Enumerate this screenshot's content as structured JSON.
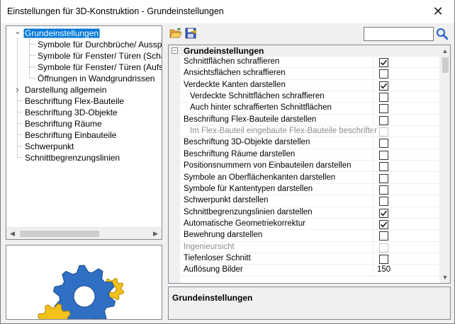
{
  "window": {
    "title": "Einstellungen für 3D-Konstruktion - Grundeinstellungen",
    "close_symbol": "✕"
  },
  "tree": {
    "items": [
      {
        "label": "Grundeinstellungen",
        "level": 0,
        "selected": true,
        "expander": "expanded"
      },
      {
        "label": "Symbole für Durchbrüche/ Aussparungen",
        "level": 1
      },
      {
        "label": "Symbole für Fenster/ Türen (Schatten)",
        "level": 1
      },
      {
        "label": "Symbole für Fenster/ Türen (Aufschlag)",
        "level": 1
      },
      {
        "label": "Öffnungen in Wandgrundrissen",
        "level": 1
      },
      {
        "label": "Darstellung allgemein",
        "level": 0,
        "expander": "collapsed"
      },
      {
        "label": "Beschriftung Flex-Bauteile",
        "level": 0
      },
      {
        "label": "Beschriftung 3D-Objekte",
        "level": 0
      },
      {
        "label": "Beschriftung Räume",
        "level": 0
      },
      {
        "label": "Beschriftung Einbauteile",
        "level": 0
      },
      {
        "label": "Schwerpunkt",
        "level": 0
      },
      {
        "label": "Schnittbegrenzungslinien",
        "level": 0
      }
    ]
  },
  "toolbar": {
    "open_icon": "folder-open-icon",
    "save_icon": "save-icon",
    "search_value": "",
    "search_icon": "magnifier-icon"
  },
  "grid": {
    "category": "Grundeinstellungen",
    "properties": [
      {
        "name": "Schnittflächen schraffieren",
        "type": "checkbox",
        "checked": true
      },
      {
        "name": "Ansichtsflächen schraffieren",
        "type": "checkbox",
        "checked": false
      },
      {
        "name": "Verdeckte Kanten darstellen",
        "type": "checkbox",
        "checked": true
      },
      {
        "name": "Verdeckte Schnittflächen schraffieren",
        "type": "checkbox",
        "checked": false,
        "indent": true
      },
      {
        "name": "Auch hinter schraffierten Schnittflächen",
        "type": "checkbox",
        "checked": false,
        "indent": true
      },
      {
        "name": "Beschriftung Flex-Bauteile darstellen",
        "type": "checkbox",
        "checked": false
      },
      {
        "name": "Im Flex-Bauteil eingebaute Flex-Bauteile beschriften",
        "type": "checkbox",
        "checked": false,
        "indent": true,
        "disabled": true
      },
      {
        "name": "Beschriftung 3D-Objekte darstellen",
        "type": "checkbox",
        "checked": false
      },
      {
        "name": "Beschriftung Räume darstellen",
        "type": "checkbox",
        "checked": false
      },
      {
        "name": "Positionsnummern von Einbauteilen darstellen",
        "type": "checkbox",
        "checked": false
      },
      {
        "name": "Symbole an Oberflächenkanten darstellen",
        "type": "checkbox",
        "checked": false
      },
      {
        "name": "Symbole für Kantentypen darstellen",
        "type": "checkbox",
        "checked": false
      },
      {
        "name": "Schwerpunkt darstellen",
        "type": "checkbox",
        "checked": false
      },
      {
        "name": "Schnittbegrenzungslinien darstellen",
        "type": "checkbox",
        "checked": true
      },
      {
        "name": "Automatische Geometriekorrektur",
        "type": "checkbox",
        "checked": true
      },
      {
        "name": "Bewehrung darstellen",
        "type": "checkbox",
        "checked": false
      },
      {
        "name": "Ingenieursicht",
        "type": "checkbox",
        "checked": false,
        "disabled": true
      },
      {
        "name": "Tiefenloser Schnitt",
        "type": "checkbox",
        "checked": false
      },
      {
        "name": "Auflösung Bilder",
        "type": "text",
        "value": "150"
      }
    ]
  },
  "description": {
    "title": "Grundeinstellungen"
  },
  "colors": {
    "selection": "#0078d7",
    "gear_blue": "#2f6fc4",
    "gear_yellow": "#f2c21b"
  }
}
